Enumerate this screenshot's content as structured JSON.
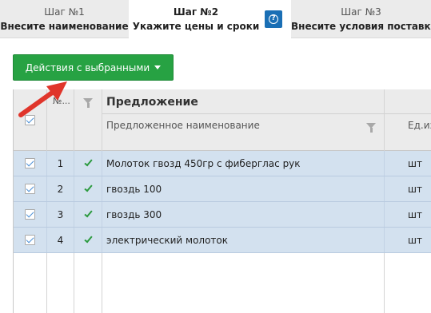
{
  "steps": [
    {
      "num": "Шаг №1",
      "title": "Внесите наименование"
    },
    {
      "num": "Шаг №2",
      "title": "Укажите цены и сроки",
      "help_icon": "question-circle-icon"
    },
    {
      "num": "Шаг №3",
      "title": "Внесите условия поставки"
    }
  ],
  "toolbar": {
    "actions_label": "Действия с выбранными",
    "actions_icon": "caret-down-icon"
  },
  "grid": {
    "columns": {
      "num": "№...",
      "group": "Предложение",
      "name": "Предложенное наименование",
      "unit": "Ед.изм."
    },
    "rows": [
      {
        "n": "1",
        "name": "Молоток гвозд 450гр с фиберглас рук",
        "unit": "шт",
        "checked": true
      },
      {
        "n": "2",
        "name": "гвоздь 100",
        "unit": "шт",
        "checked": true
      },
      {
        "n": "3",
        "name": "гвоздь 300",
        "unit": "шт",
        "checked": true
      },
      {
        "n": "4",
        "name": "электрический молоток",
        "unit": "шт",
        "checked": true
      }
    ]
  },
  "colors": {
    "accent_green": "#27a243",
    "help_blue": "#1a6fb5",
    "row_selected": "#d3e1ef",
    "arrow_red": "#e0352b"
  }
}
